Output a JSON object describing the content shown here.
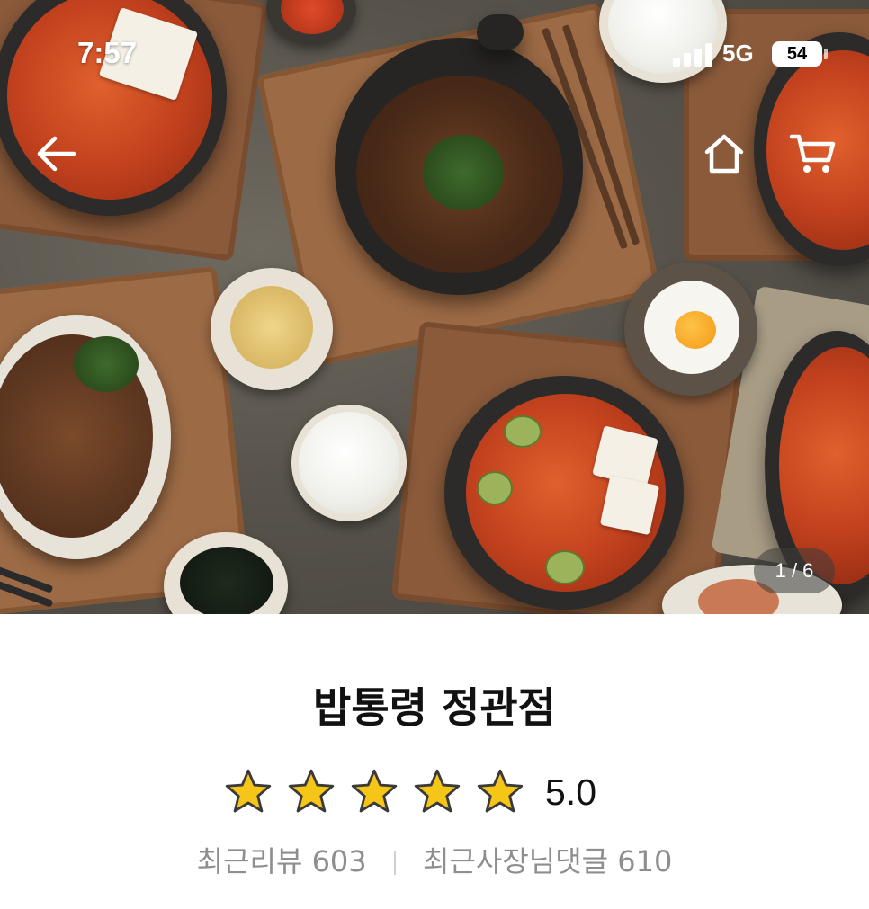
{
  "status_bar": {
    "time": "7:57",
    "network": "5G",
    "battery": "54",
    "icons": [
      "signal-icon",
      "battery-icon"
    ]
  },
  "header": {
    "icons": [
      "back-arrow-icon",
      "home-icon",
      "cart-icon"
    ]
  },
  "carousel": {
    "image_description_icon": "food-photo",
    "page_indicator": "1 / 6"
  },
  "store": {
    "name": "밥통령 정관점",
    "rating": 5.0,
    "rating_text": "5.0",
    "stars_total": 5,
    "stars_filled": 5,
    "star_color": "#f5c518"
  },
  "reviews": {
    "recent_reviews_label": "최근리뷰 603",
    "owner_replies_label": "최근사장님댓글 610"
  }
}
